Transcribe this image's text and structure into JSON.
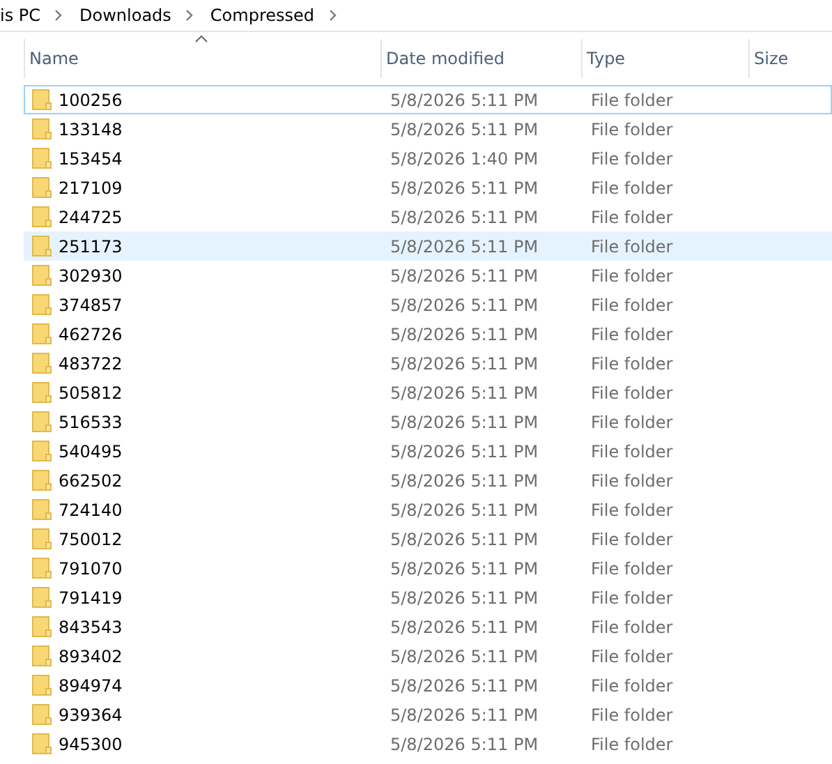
{
  "breadcrumb": [
    "is PC",
    "Downloads",
    "Compressed"
  ],
  "table": {
    "columns": [
      {
        "label": "Name",
        "sorted": true
      },
      {
        "label": "Date modified",
        "sorted": false
      },
      {
        "label": "Type",
        "sorted": false
      },
      {
        "label": "Size",
        "sorted": false
      }
    ],
    "rows": [
      {
        "name": "100256",
        "date": "5/8/2026 5:11 PM",
        "type": "File folder",
        "focused": true,
        "selected": false
      },
      {
        "name": "133148",
        "date": "5/8/2026 5:11 PM",
        "type": "File folder",
        "focused": false,
        "selected": false
      },
      {
        "name": "153454",
        "date": "5/8/2026 1:40 PM",
        "type": "File folder",
        "focused": false,
        "selected": false
      },
      {
        "name": "217109",
        "date": "5/8/2026 5:11 PM",
        "type": "File folder",
        "focused": false,
        "selected": false
      },
      {
        "name": "244725",
        "date": "5/8/2026 5:11 PM",
        "type": "File folder",
        "focused": false,
        "selected": false
      },
      {
        "name": "251173",
        "date": "5/8/2026 5:11 PM",
        "type": "File folder",
        "focused": false,
        "selected": true
      },
      {
        "name": "302930",
        "date": "5/8/2026 5:11 PM",
        "type": "File folder",
        "focused": false,
        "selected": false
      },
      {
        "name": "374857",
        "date": "5/8/2026 5:11 PM",
        "type": "File folder",
        "focused": false,
        "selected": false
      },
      {
        "name": "462726",
        "date": "5/8/2026 5:11 PM",
        "type": "File folder",
        "focused": false,
        "selected": false
      },
      {
        "name": "483722",
        "date": "5/8/2026 5:11 PM",
        "type": "File folder",
        "focused": false,
        "selected": false
      },
      {
        "name": "505812",
        "date": "5/8/2026 5:11 PM",
        "type": "File folder",
        "focused": false,
        "selected": false
      },
      {
        "name": "516533",
        "date": "5/8/2026 5:11 PM",
        "type": "File folder",
        "focused": false,
        "selected": false
      },
      {
        "name": "540495",
        "date": "5/8/2026 5:11 PM",
        "type": "File folder",
        "focused": false,
        "selected": false
      },
      {
        "name": "662502",
        "date": "5/8/2026 5:11 PM",
        "type": "File folder",
        "focused": false,
        "selected": false
      },
      {
        "name": "724140",
        "date": "5/8/2026 5:11 PM",
        "type": "File folder",
        "focused": false,
        "selected": false
      },
      {
        "name": "750012",
        "date": "5/8/2026 5:11 PM",
        "type": "File folder",
        "focused": false,
        "selected": false
      },
      {
        "name": "791070",
        "date": "5/8/2026 5:11 PM",
        "type": "File folder",
        "focused": false,
        "selected": false
      },
      {
        "name": "791419",
        "date": "5/8/2026 5:11 PM",
        "type": "File folder",
        "focused": false,
        "selected": false
      },
      {
        "name": "843543",
        "date": "5/8/2026 5:11 PM",
        "type": "File folder",
        "focused": false,
        "selected": false
      },
      {
        "name": "893402",
        "date": "5/8/2026 5:11 PM",
        "type": "File folder",
        "focused": false,
        "selected": false
      },
      {
        "name": "894974",
        "date": "5/8/2026 5:11 PM",
        "type": "File folder",
        "focused": false,
        "selected": false
      },
      {
        "name": "939364",
        "date": "5/8/2026 5:11 PM",
        "type": "File folder",
        "focused": false,
        "selected": false
      },
      {
        "name": "945300",
        "date": "5/8/2026 5:11 PM",
        "type": "File folder",
        "focused": false,
        "selected": false
      }
    ]
  }
}
